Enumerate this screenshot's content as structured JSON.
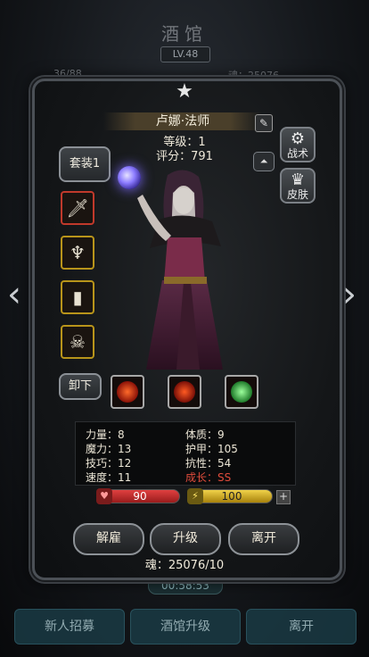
{
  "background": {
    "title": "酒馆",
    "level": "LV.48",
    "stat_left": "36/88",
    "stat_right": "魂：25076",
    "timer": "00:58:53",
    "bottom_buttons": [
      "新人招募",
      "酒馆升级",
      "离开"
    ]
  },
  "hero": {
    "name": "卢娜·法师",
    "level_label": "等级：1",
    "score_label": "评分：791"
  },
  "side_buttons": {
    "set": "套装1",
    "tactics": "战术",
    "skin": "皮肤",
    "unequip": "卸下"
  },
  "icons": {
    "star": "star-icon",
    "edit": "edit-icon",
    "gear": "gear-icon",
    "skin": "skin-icon",
    "up": "up-arrow-icon",
    "heart": "heart-icon",
    "energy": "lightning-icon",
    "plus": "plus-icon",
    "left": "chevron-left-icon",
    "right": "chevron-right-icon"
  },
  "stats": {
    "strength": "力量：8",
    "magic": "魔力：13",
    "skill": "技巧：12",
    "speed": "速度：11",
    "constitution": "体质：9",
    "armor": "护甲：105",
    "resistance": "抗性：54",
    "growth": "成长：SS"
  },
  "bars": {
    "hp": "90",
    "energy": "100"
  },
  "actions": {
    "dismiss": "解雇",
    "upgrade": "升级",
    "leave": "离开"
  },
  "soul": "魂：25076/10",
  "colors": {
    "hp_bar": "#c0282c",
    "energy_bar": "#d9b21a",
    "growth_text": "#e04c3c",
    "equip_border": "#b8941a"
  }
}
